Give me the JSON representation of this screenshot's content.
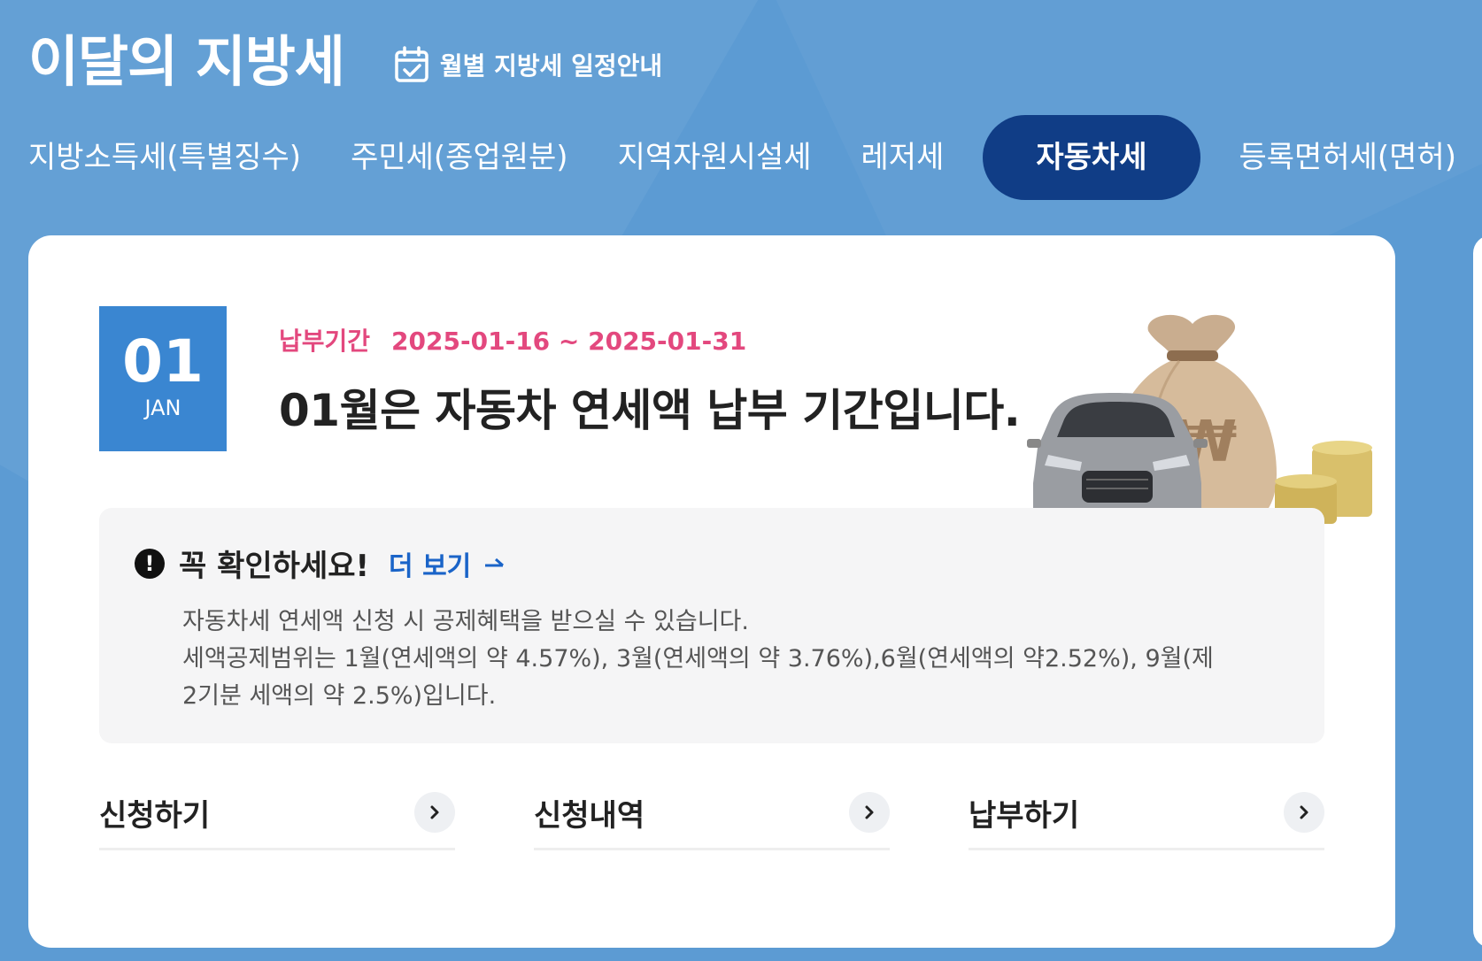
{
  "header": {
    "title": "이달의 지방세",
    "schedule_link": "월별 지방세 일정안내"
  },
  "tabs": [
    {
      "label": "지방소득세(특별징수)"
    },
    {
      "label": "주민세(종업원분)"
    },
    {
      "label": "지역자원시설세"
    },
    {
      "label": "레저세"
    },
    {
      "label": "자동차세",
      "active": true
    },
    {
      "label": "등록면허세(면허)"
    }
  ],
  "card": {
    "date": {
      "day": "01",
      "month": "JAN"
    },
    "period_label": "납부기간",
    "period_value": "2025-01-16 ~ 2025-01-31",
    "headline": "01월은 자동차 연세액 납부 기간입니다.",
    "notice": {
      "title": "꼭 확인하세요!",
      "more": "더 보기",
      "lines": [
        "자동차세 연세액 신청 시 공제혜택을 받으실 수 있습니다.",
        "세액공제범위는 1월(연세액의 약 4.57%), 3월(연세액의 약 3.76%),6월(연세액의 약2.52%), 9월(제",
        "2기분 세액의 약 2.5%)입니다."
      ]
    },
    "actions": [
      {
        "label": "신청하기"
      },
      {
        "label": "신청내역"
      },
      {
        "label": "납부하기"
      }
    ],
    "illustration": {
      "money_symbol": "₩"
    }
  },
  "colors": {
    "background": "#5c9bd3",
    "active_tab": "#103d86",
    "date_box": "#3a86d1",
    "period": "#e3487e",
    "link": "#1a64c8"
  }
}
